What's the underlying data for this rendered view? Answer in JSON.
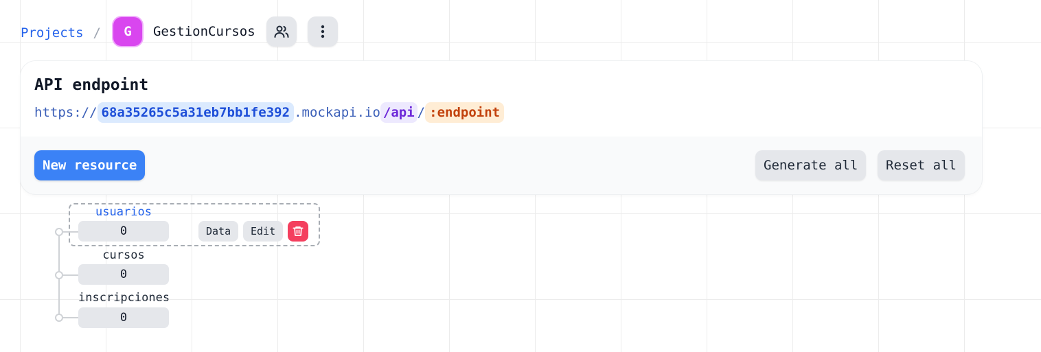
{
  "breadcrumb": {
    "projects_label": "Projects",
    "separator": "/",
    "avatar_letter": "G",
    "project_name": "GestionCursos"
  },
  "icons": {
    "members": "users-icon",
    "menu": "more-vertical-icon",
    "delete": "trash-icon"
  },
  "endpoint_card": {
    "title": "API endpoint",
    "url": {
      "scheme": "https://",
      "project_id": "68a35265c5a31eb7bb1fe392",
      "domain": ".mockapi.io",
      "prefix": "/api",
      "slash": "/",
      "endpoint": ":endpoint"
    },
    "new_resource_label": "New resource",
    "generate_all_label": "Generate all",
    "reset_all_label": "Reset all"
  },
  "resources": [
    {
      "name": "usuarios",
      "count": "0",
      "selected": true
    },
    {
      "name": "cursos",
      "count": "0",
      "selected": false
    },
    {
      "name": "inscripciones",
      "count": "0",
      "selected": false
    }
  ],
  "resource_actions": {
    "data_label": "Data",
    "edit_label": "Edit"
  },
  "colors": {
    "accent": "#3b82f6",
    "avatar": "#d946ef",
    "danger": "#f43f5e",
    "link": "#2563eb"
  }
}
